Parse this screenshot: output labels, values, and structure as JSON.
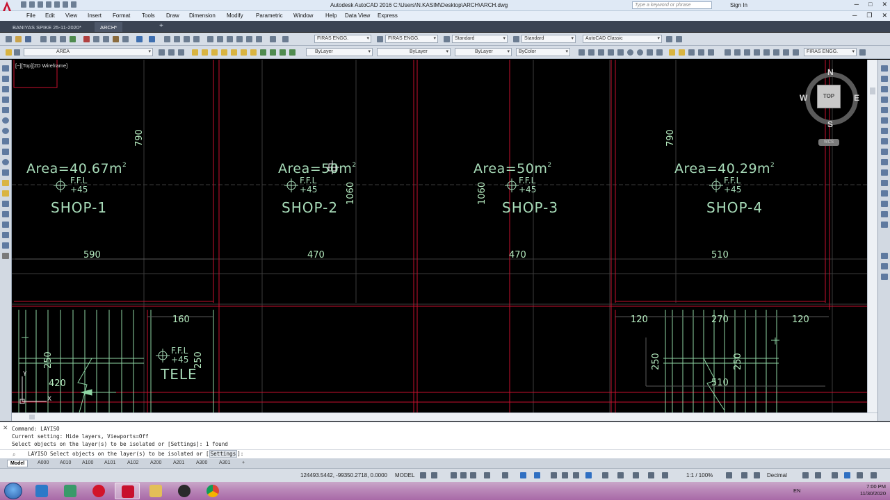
{
  "titlebar": {
    "title": "Autodesk AutoCAD 2016    C:\\Users\\N.KASIM\\Desktop\\ARCH\\ARCH.dwg",
    "search_placeholder": "Type a keyword or phrase",
    "sign_in": "Sign In"
  },
  "menu": [
    "File",
    "Edit",
    "View",
    "Insert",
    "Format",
    "Tools",
    "Draw",
    "Dimension",
    "Modify",
    "Parametric",
    "Window",
    "Help",
    "Data View",
    "Express"
  ],
  "file_tabs": [
    "BANIYAS SPIKE 25-11-2020*",
    "ARCH*"
  ],
  "toolbar1": {
    "text_style": "FIRAS ENGG.",
    "dim_style": "FIRAS ENGG.",
    "table_style": "Standard",
    "mleader_style": "Standard",
    "workspace": "AutoCAD Classic"
  },
  "toolbar2": {
    "layer": "AREA",
    "color": "ByLayer",
    "linetype": "ByLayer",
    "lineweight": "ByLayer",
    "plotstyle": "ByColor",
    "annoscale": "FIRAS ENGG."
  },
  "viewport_label": "[−][Top][2D Wireframe]",
  "viewcube": {
    "top": "TOP",
    "north": "N",
    "south": "S",
    "east": "E",
    "west": "W",
    "wcs": "WCS"
  },
  "drawing": {
    "shops": [
      {
        "name": "SHOP-1",
        "area_value": "Area=40.67m",
        "ffl1": "F.F.L",
        "ffl2": "+45",
        "width": "590"
      },
      {
        "name": "SHOP-2",
        "area_value": "Area=50m",
        "ffl1": "F.F.L",
        "ffl2": "+45",
        "width": "470"
      },
      {
        "name": "SHOP-3",
        "area_value": "Area=50m",
        "ffl1": "F.F.L",
        "ffl2": "+45",
        "width": "470"
      },
      {
        "name": "SHOP-4",
        "area_value": "Area=40.29m",
        "ffl1": "F.F.L",
        "ffl2": "+45",
        "width": "510"
      }
    ],
    "area_sup": "2",
    "dims": {
      "v790a": "790",
      "v790b": "790",
      "v1060a": "1060",
      "v1060b": "1060",
      "d160": "160",
      "d420": "420",
      "d250a": "250",
      "d250b": "250",
      "d120a": "120",
      "d270": "270",
      "d120b": "120",
      "d250c": "250",
      "d250d": "250",
      "d510": "510"
    },
    "tele": {
      "name": "TELE",
      "ffl1": "F.F.L",
      "ffl2": "+45"
    },
    "ucs_y": "Y",
    "ucs_x": "X"
  },
  "command": {
    "history": [
      "Command: LAYISO",
      "Current setting: Hide layers, Viewports=Off",
      "Select objects on the layer(s) to be isolated or [Settings]: 1 found"
    ],
    "prompt": "LAYISO Select objects on the layer(s) to be isolated or [",
    "prompt_option": "Settings",
    "prompt_end": "]:"
  },
  "layout_tabs": [
    "Model",
    "A000",
    "A010",
    "A100",
    "A101",
    "A102",
    "A200",
    "A201",
    "A300",
    "A301"
  ],
  "status": {
    "coords": "124493.5442, -99350.2718, 0.0000",
    "space": "MODEL",
    "scale": "1:1 / 100%",
    "units": "Decimal"
  },
  "taskbar": {
    "lang": "EN",
    "time": "7:00 PM",
    "date": "11/30/2020"
  },
  "colors": {
    "cad_text": "#a8dcb9",
    "red_lines": "#c8102e",
    "grid_lines": "#3a3a3a",
    "background": "#000000"
  }
}
